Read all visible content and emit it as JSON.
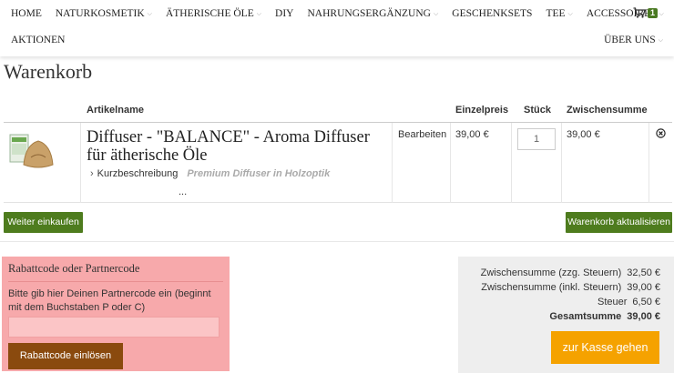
{
  "nav": {
    "items": [
      {
        "label": "HOME",
        "has_dropdown": false
      },
      {
        "label": "NATURKOSMETIK",
        "has_dropdown": true
      },
      {
        "label": "ÄTHERISCHE ÖLE",
        "has_dropdown": true
      },
      {
        "label": "DIY",
        "has_dropdown": false
      },
      {
        "label": "NAHRUNGSERGÄNZUNG",
        "has_dropdown": true
      },
      {
        "label": "GESCHENKSETS",
        "has_dropdown": false
      },
      {
        "label": "TEE",
        "has_dropdown": true
      },
      {
        "label": "ACCESSOIRES",
        "has_dropdown": true
      }
    ],
    "aktionen": "AKTIONEN",
    "about": "ÜBER UNS",
    "cart_count": "1"
  },
  "page_title": "Warenkorb",
  "table": {
    "headers": {
      "artikel": "Artikelname",
      "einzelpreis": "Einzelpreis",
      "stueck": "Stück",
      "zwischensumme": "Zwischensumme"
    },
    "row": {
      "name": "Diffuser - \"BALANCE\" - Aroma Diffuser für ätherische Öle",
      "kurz_label": "Kurzbeschreibung",
      "kurz_desc": "Premium Diffuser in Holzoptik",
      "ellipsis": "...",
      "edit": "Bearbeiten",
      "price": "39,00 €",
      "quantity": "1",
      "subtotal": "39,00 €",
      "thumb_label": "BALANCE"
    }
  },
  "buttons": {
    "continue": "Weiter einkaufen",
    "update": "Warenkorb aktualisieren",
    "coupon_apply": "Rabattcode einlösen",
    "checkout": "zur Kasse gehen"
  },
  "coupon": {
    "title": "Rabattcode oder Partnercode",
    "text": "Bitte gib hier Deinen Partnercode ein (beginnt mit dem Buchstaben P oder C)",
    "value": ""
  },
  "totals": [
    {
      "label": "Zwischensumme (zzg. Steuern)",
      "value": "32,50 €",
      "bold": false
    },
    {
      "label": "Zwischensumme (inkl. Steuern)",
      "value": "39,00 €",
      "bold": false
    },
    {
      "label": "Steuer",
      "value": "6,50 €",
      "bold": false
    },
    {
      "label": "Gesamtsumme",
      "value": "39,00 €",
      "bold": true
    }
  ],
  "colors": {
    "green": "#4e7c1e",
    "coupon_bg": "#f7a9ab",
    "coupon_btn": "#8a4a0e",
    "checkout": "#f5a200",
    "totals_bg": "#eeeeee"
  }
}
